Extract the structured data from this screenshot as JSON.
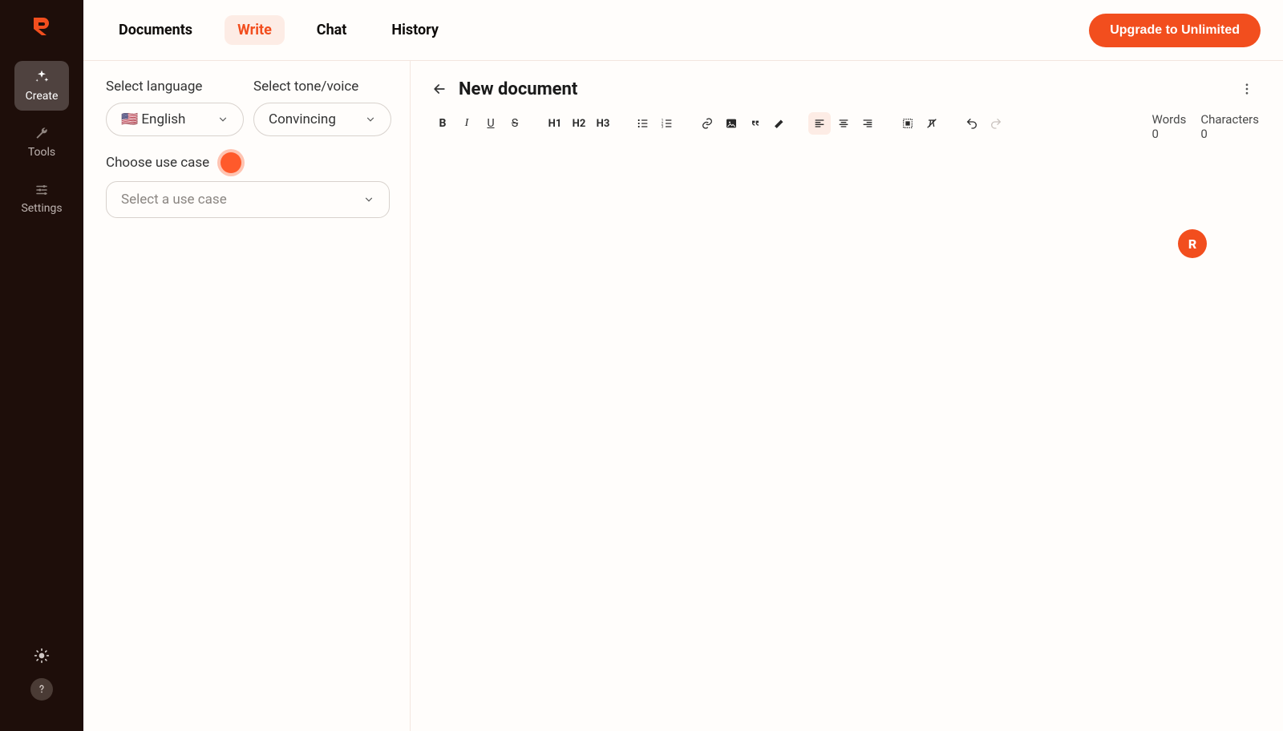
{
  "brand_letter": "R",
  "sidebar": {
    "items": [
      {
        "label": "Create",
        "icon": "sparkle-icon",
        "active": true
      },
      {
        "label": "Tools",
        "icon": "wrench-icon",
        "active": false
      },
      {
        "label": "Settings",
        "icon": "sliders-icon",
        "active": false
      }
    ]
  },
  "top_tabs": [
    {
      "label": "Documents",
      "active": false
    },
    {
      "label": "Write",
      "active": true
    },
    {
      "label": "Chat",
      "active": false
    },
    {
      "label": "History",
      "active": false
    }
  ],
  "upgrade_label": "Upgrade to Unlimited",
  "left_panel": {
    "language_label": "Select language",
    "language_value": "English",
    "language_flag": "🇺🇸",
    "tone_label": "Select tone/voice",
    "tone_value": "Convincing",
    "usecase_label": "Choose use case",
    "usecase_placeholder": "Select a use case"
  },
  "document": {
    "title": "New document",
    "words_label": "Words",
    "words_value": "0",
    "chars_label": "Characters",
    "chars_value": "0"
  },
  "toolbar": {
    "bold": "B",
    "italic": "I",
    "underline": "U",
    "strike": "S",
    "h1": "H1",
    "h2": "H2",
    "h3": "H3"
  },
  "float_badge_letter": "R"
}
